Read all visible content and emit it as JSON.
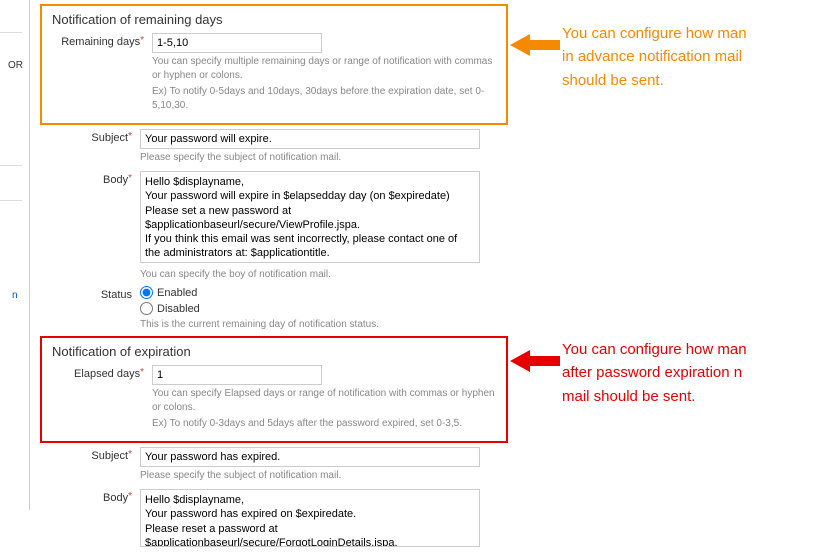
{
  "leftSidebar": {
    "txtOr": "OR",
    "txtN": "n"
  },
  "section1": {
    "title": "Notification of remaining days",
    "remaining": {
      "label": "Remaining days",
      "value": "1-5,10",
      "hint1": "You can specify multiple remaining days or range of notification with commas or hyphen or colons.",
      "hint2": "Ex) To notify 0-5days and 10days, 30days before the expiration date, set 0-5,10,30."
    }
  },
  "subject1": {
    "label": "Subject",
    "value": "Your password will expire.",
    "hint": "Please specify the subject of notification mail."
  },
  "body1": {
    "label": "Body",
    "value": "Hello $displayname,\nYour password will expire in $elapsedday day (on $expiredate)\nPlease set a new password at $applicationbaseurl/secure/ViewProfile.jspa.\nIf you think this email was sent incorrectly, please contact one of the administrators at: $applicationtitle.",
    "hint": "You can specify the boy of notification mail."
  },
  "status": {
    "label": "Status",
    "enabled": "Enabled",
    "disabled": "Disabled",
    "hint": "This is the current remaining day of notification status."
  },
  "section2": {
    "title": "Notification of expiration",
    "elapsed": {
      "label": "Elapsed days",
      "value": "1",
      "hint1": "You can specify Elapsed days or range of notification with commas or hyphen or colons.",
      "hint2": "Ex) To notify 0-3days and 5days after the password expired, set 0-3,5."
    }
  },
  "subject2": {
    "label": "Subject",
    "value": "Your password has expired.",
    "hint": "Please specify the subject of notification mail."
  },
  "body2": {
    "label": "Body",
    "value": "Hello $displayname,\nYour password has expired on $expiredate.\nPlease reset a password at $applicationbaseurl/secure/ForgotLoginDetails.jspa.\nIf you think this email was sent incorrectly, please contact one of the administrators at: $applicationtitle."
  },
  "callout1": "You can configure how man\nin advance notification mail\nshould be sent.",
  "callout2": "You can configure how man\nafter password expiration n\nmail should be sent."
}
